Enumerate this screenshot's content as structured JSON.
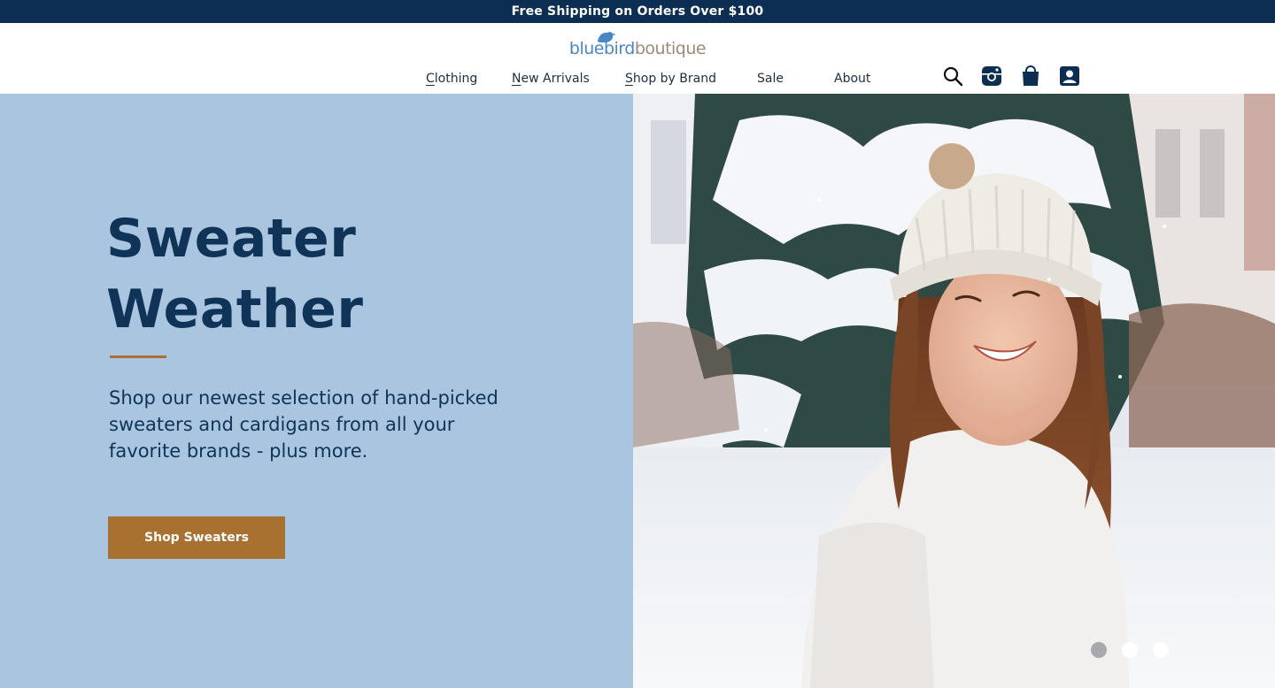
{
  "promo": {
    "text": "Free Shipping on Orders Over $100"
  },
  "logo": {
    "part1": "bluebird",
    "part2": "boutique"
  },
  "nav": {
    "items": [
      {
        "first": "C",
        "rest": "lothing"
      },
      {
        "first": "N",
        "rest": "ew Arrivals"
      },
      {
        "first": "S",
        "rest": "hop by Brand"
      },
      {
        "first": "",
        "rest": "Sale"
      },
      {
        "first": "",
        "rest": "About"
      }
    ]
  },
  "header_icons": [
    "search-icon",
    "instagram-icon",
    "shopping-bag-icon",
    "account-icon"
  ],
  "hero": {
    "title_line1": "Sweater",
    "title_line2": "Weather",
    "body": "Shop our newest selection of hand-picked sweaters and cardigans from all your favorite brands - plus more.",
    "cta_label": "Shop Sweaters",
    "image": "woman-in-snow-photo"
  },
  "carousel": {
    "slides": 3,
    "active_index": 0
  },
  "colors": {
    "promo_bg": "#0b2e52",
    "hero_bg": "#a9c5e0",
    "heading": "#0f3457",
    "accent": "#a9712f",
    "dot_active": "#a7a9ac",
    "dot_inactive": "#ffffff"
  }
}
